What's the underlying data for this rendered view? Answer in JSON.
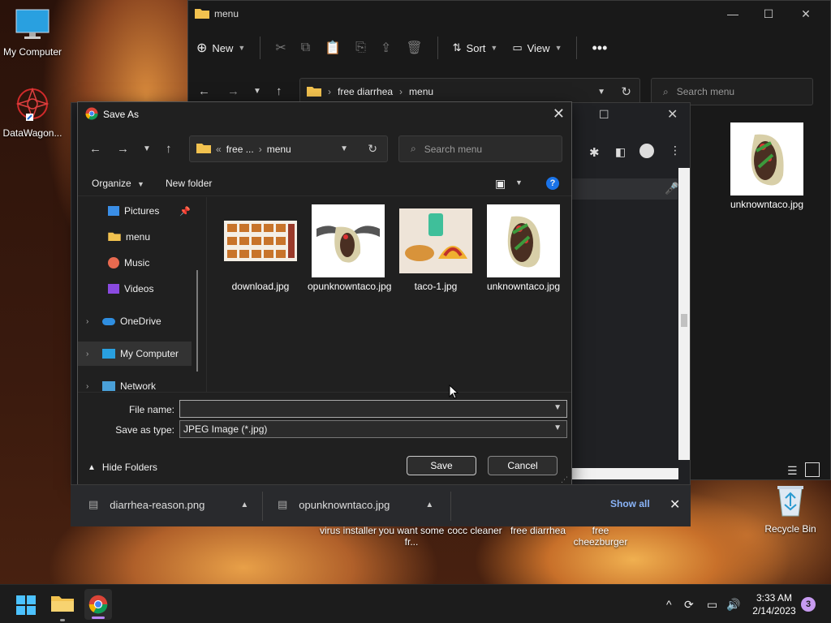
{
  "desktop": {
    "icons": [
      {
        "label": "My Computer"
      },
      {
        "label": "DataWagon..."
      },
      {
        "label": "unknowntaco.jpg"
      },
      {
        "label": "Recycle Bin"
      }
    ],
    "bottom_labels": [
      {
        "label": "virus installer"
      },
      {
        "label": "you want some fr..."
      },
      {
        "label": "cocc cleaner"
      },
      {
        "label": "free diarrhea"
      },
      {
        "label": "free cheezburger"
      }
    ]
  },
  "explorer": {
    "title": "menu",
    "toolbar": {
      "new": "New",
      "sort": "Sort",
      "view": "View"
    },
    "breadcrumb": [
      "free diarrhea",
      "menu"
    ],
    "search_placeholder": "Search menu"
  },
  "dialog": {
    "title": "Save As",
    "breadcrumb": [
      "free ...",
      "menu"
    ],
    "search_placeholder": "Search menu",
    "organize": "Organize",
    "new_folder": "New folder",
    "sidebar": [
      {
        "label": "Pictures"
      },
      {
        "label": "menu"
      },
      {
        "label": "Music"
      },
      {
        "label": "Videos"
      },
      {
        "label": "OneDrive"
      },
      {
        "label": "My Computer"
      },
      {
        "label": "Network"
      }
    ],
    "files": [
      {
        "name": "download.jpg"
      },
      {
        "name": "opunknowntaco.jpg"
      },
      {
        "name": "taco-1.jpg"
      },
      {
        "name": "unknowntaco.jpg"
      }
    ],
    "file_name_label": "File name:",
    "file_name_value": "",
    "save_type_label": "Save as type:",
    "save_type_value": "JPEG Image (*.jpg)",
    "hide_folders": "Hide Folders",
    "save": "Save",
    "cancel": "Cancel"
  },
  "downloads": {
    "items": [
      {
        "name": "diarrhea-reason.png"
      },
      {
        "name": "opunknowntaco.jpg"
      }
    ],
    "show_all": "Show all"
  },
  "taskbar": {
    "time": "3:33 AM",
    "date": "2/14/2023",
    "notifications": "3"
  }
}
